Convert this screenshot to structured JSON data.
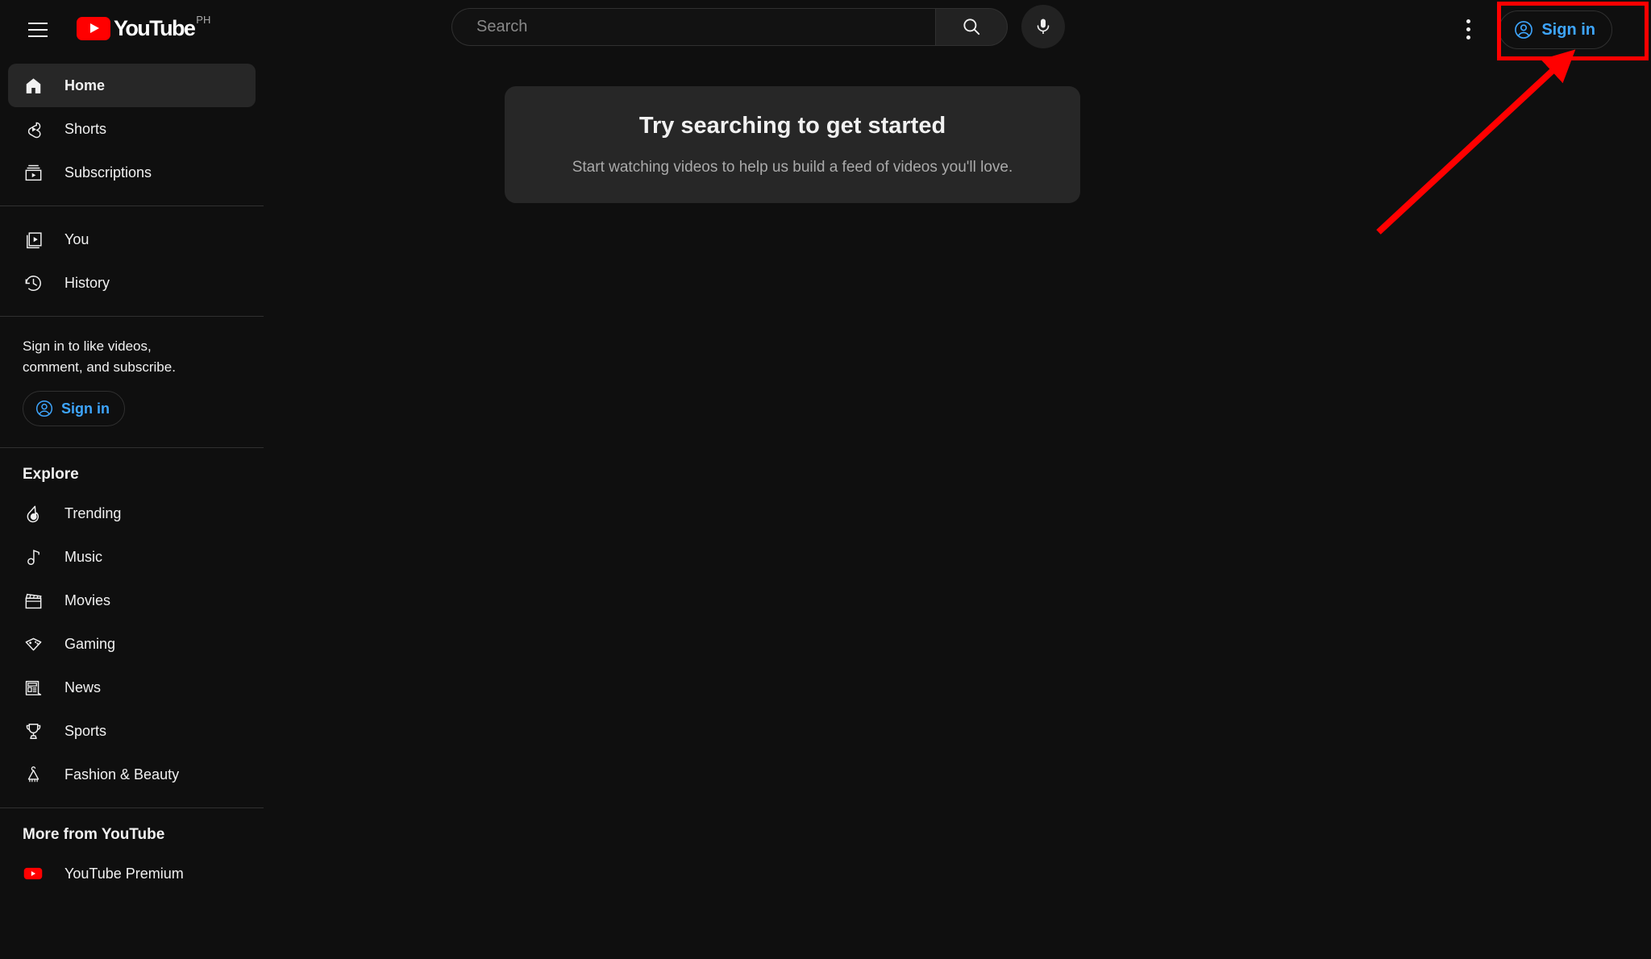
{
  "header": {
    "menu_icon": "hamburger-icon",
    "logo": {
      "text": "YouTube",
      "country": "PH"
    },
    "search": {
      "placeholder": "Search",
      "value": "",
      "button_icon": "search-icon"
    },
    "voice_search_icon": "microphone-icon",
    "settings_icon": "kebab-menu-icon",
    "sign_in_label": "Sign in",
    "sign_in_icon": "account-circle-icon"
  },
  "sidebar": {
    "primary": [
      {
        "label": "Home",
        "icon": "home-icon",
        "active": true
      },
      {
        "label": "Shorts",
        "icon": "shorts-icon",
        "active": false
      },
      {
        "label": "Subscriptions",
        "icon": "subscriptions-icon",
        "active": false
      }
    ],
    "secondary": [
      {
        "label": "You",
        "icon": "you-library-icon",
        "active": false
      },
      {
        "label": "History",
        "icon": "history-clock-icon",
        "active": false
      }
    ],
    "sign_in_prompt": "Sign in to like videos, comment, and subscribe.",
    "sign_in_label": "Sign in",
    "sign_in_icon": "account-circle-icon",
    "explore_title": "Explore",
    "explore": [
      {
        "label": "Trending",
        "icon": "trending-flame-icon"
      },
      {
        "label": "Music",
        "icon": "music-note-icon"
      },
      {
        "label": "Movies",
        "icon": "movies-clapperboard-icon"
      },
      {
        "label": "Gaming",
        "icon": "gaming-controller-icon"
      },
      {
        "label": "News",
        "icon": "news-paper-icon"
      },
      {
        "label": "Sports",
        "icon": "sports-trophy-icon"
      },
      {
        "label": "Fashion & Beauty",
        "icon": "fashion-hanger-icon"
      }
    ],
    "more_title": "More from YouTube",
    "more": [
      {
        "label": "YouTube Premium",
        "icon": "youtube-premium-icon"
      }
    ]
  },
  "main": {
    "empty_state": {
      "title": "Try searching to get started",
      "subtitle": "Start watching videos to help us build a feed of videos you'll love."
    }
  },
  "annotation": {
    "color": "#ff0000",
    "target": "sign-in-button"
  },
  "colors": {
    "background": "#0f0f0f",
    "surface": "#272727",
    "accent_blue": "#3ea6ff",
    "brand_red": "#ff0000",
    "text_primary": "#f1f1f1",
    "text_secondary": "#aaaaaa"
  }
}
